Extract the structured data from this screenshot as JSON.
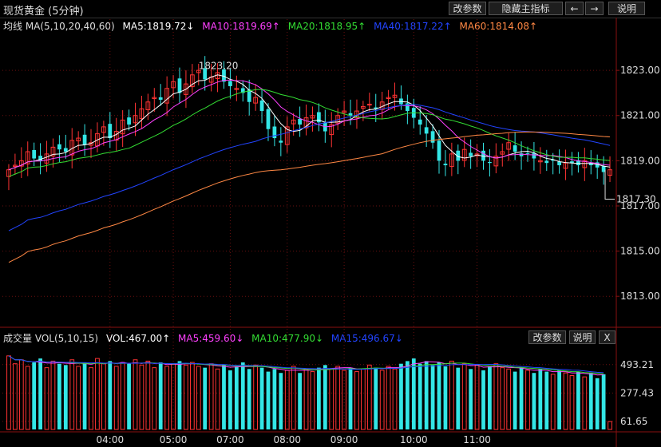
{
  "header": {
    "title": "现货黄金 (5分钟)",
    "buttons": [
      "改参数",
      "隐藏主指标",
      "←",
      "→",
      "说明"
    ]
  },
  "main_legend": {
    "label": "均线 MA(5,10,20,40,60)",
    "items": [
      {
        "text": "MA5:1819.72↓",
        "color": "#ffffff"
      },
      {
        "text": "MA10:1819.69↑",
        "color": "#ff40ff"
      },
      {
        "text": "MA20:1818.95↑",
        "color": "#33dd33"
      },
      {
        "text": "MA40:1817.22↑",
        "color": "#2244ff"
      },
      {
        "text": "MA60:1814.08↑",
        "color": "#ff8844"
      }
    ]
  },
  "vol_legend": {
    "label": "成交量 VOL(5,10,15)",
    "items": [
      {
        "text": "VOL:467.00↑",
        "color": "#ffffff"
      },
      {
        "text": "MA5:459.60↓",
        "color": "#ff40ff"
      },
      {
        "text": "MA10:477.90↓",
        "color": "#33dd33"
      },
      {
        "text": "MA15:496.67↓",
        "color": "#2244ff"
      }
    ],
    "buttons": [
      "改参数",
      "说明",
      "X"
    ]
  },
  "chart_data": [
    {
      "type": "candlestick",
      "title": "现货黄金 (5分钟)",
      "y_ticks": [
        "1823.00",
        "1821.00",
        "1819.00",
        "1817.00",
        "1815.00",
        "1813.00"
      ],
      "ylim": [
        1811.7,
        1824.7
      ],
      "annotations": [
        {
          "text": "1823.20",
          "kind": "high"
        },
        {
          "text": "1817.30",
          "kind": "low"
        }
      ],
      "x_ticks": [
        "04:00",
        "05:00",
        "07:00",
        "08:00",
        "09:00",
        "10:00",
        "11:00"
      ],
      "colors": {
        "up": "#ff3333",
        "down": "#33e6e6"
      },
      "close_series_approx": [
        1818.6,
        1818.8,
        1819.0,
        1819.4,
        1819.1,
        1819.0,
        1819.3,
        1819.6,
        1819.5,
        1819.4,
        1819.9,
        1820.0,
        1819.7,
        1819.8,
        1820.2,
        1820.5,
        1820.0,
        1820.3,
        1820.8,
        1820.6,
        1821.0,
        1821.3,
        1821.6,
        1821.8,
        1821.7,
        1822.2,
        1822.5,
        1822.0,
        1822.4,
        1822.8,
        1823.0,
        1822.6,
        1822.7,
        1822.9,
        1822.5,
        1822.3,
        1822.2,
        1822.0,
        1821.6,
        1821.8,
        1821.2,
        1820.4,
        1820.0,
        1819.8,
        1820.5,
        1820.8,
        1820.6,
        1820.9,
        1821.0,
        1820.7,
        1820.3,
        1820.6,
        1821.0,
        1821.2,
        1821.0,
        1821.2,
        1821.4,
        1821.5,
        1821.3,
        1821.6,
        1821.8,
        1821.9,
        1821.5,
        1821.2,
        1820.9,
        1820.6,
        1820.2,
        1819.8,
        1819.0,
        1818.8,
        1819.3,
        1819.0,
        1819.5,
        1819.2,
        1819.3,
        1819.0,
        1818.9,
        1819.2,
        1819.4,
        1819.8,
        1819.4,
        1819.2,
        1819.3,
        1819.1,
        1819.0,
        1818.9,
        1819.0,
        1818.8,
        1818.9,
        1818.9,
        1818.8,
        1819.0,
        1818.8,
        1818.7,
        1818.5,
        1818.6
      ]
    },
    {
      "type": "bar",
      "title": "成交量 VOL(5,10,15)",
      "y_ticks": [
        "493.21",
        "277.43",
        "61.65"
      ],
      "ylim": [
        0,
        650
      ],
      "x_ticks": [
        "04:00",
        "05:00",
        "07:00",
        "08:00",
        "09:00",
        "10:00",
        "11:00"
      ],
      "values_approx": [
        560,
        500,
        530,
        480,
        510,
        540,
        470,
        520,
        500,
        490,
        530,
        480,
        510,
        470,
        540,
        500,
        520,
        480,
        510,
        500,
        530,
        490,
        520,
        470,
        510,
        480,
        500,
        520,
        490,
        510,
        480,
        470,
        500,
        460,
        490,
        450,
        480,
        510,
        460,
        490,
        470,
        440,
        460,
        430,
        450,
        480,
        430,
        460,
        440,
        470,
        490,
        460,
        480,
        450,
        470,
        440,
        460,
        490,
        470,
        450,
        480,
        460,
        500,
        520,
        540,
        500,
        520,
        490,
        510,
        480,
        520,
        470,
        500,
        460,
        490,
        450,
        480,
        500,
        470,
        460,
        440,
        470,
        450,
        430,
        460,
        440,
        420,
        450,
        430,
        410,
        440,
        400,
        430,
        390,
        420,
        60
      ]
    }
  ]
}
